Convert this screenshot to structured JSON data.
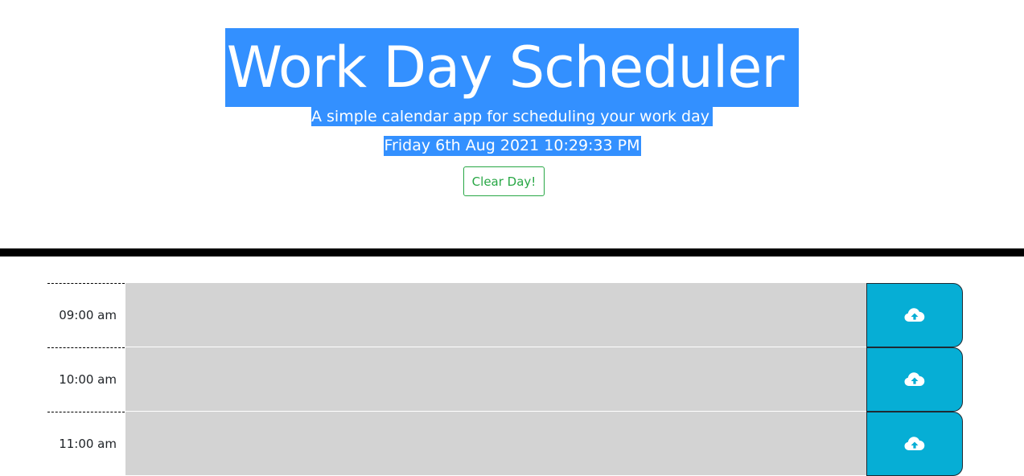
{
  "header": {
    "title": "Work Day Scheduler",
    "subtitle": "A simple calendar app for scheduling your work day",
    "current_datetime": "Friday 6th Aug 2021 10:29:33 PM",
    "clear_button_label": "Clear Day!"
  },
  "planner": {
    "rows": [
      {
        "hour": "09:00 am",
        "event": "",
        "status": "past"
      },
      {
        "hour": "10:00 am",
        "event": "",
        "status": "past"
      },
      {
        "hour": "11:00 am",
        "event": "",
        "status": "past"
      }
    ],
    "save_icon": "cloud-upload-icon"
  },
  "colors": {
    "highlight": "#3390ff",
    "clear_button": "#28a745",
    "past_row": "#d3d3d3",
    "save_button": "#06aed5",
    "divider": "#000000"
  }
}
